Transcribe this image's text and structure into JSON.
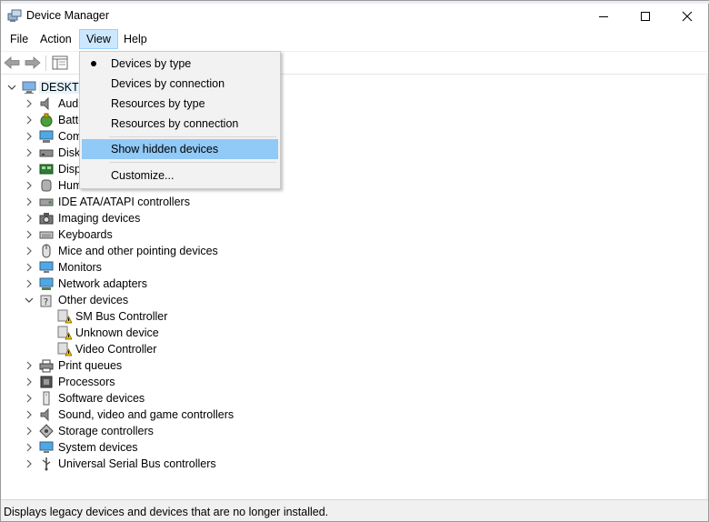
{
  "window": {
    "title": "Device Manager"
  },
  "menubar": {
    "items": [
      "File",
      "Action",
      "View",
      "Help"
    ],
    "active": "View"
  },
  "view_menu": {
    "items": [
      {
        "label": "Devices by type",
        "checked": true
      },
      {
        "label": "Devices by connection"
      },
      {
        "label": "Resources by type"
      },
      {
        "label": "Resources by connection"
      },
      {
        "label": "Show hidden devices",
        "highlighted": true
      },
      {
        "label": "Customize..."
      }
    ]
  },
  "tree": {
    "root": "DESKTO",
    "categories": [
      {
        "label": "Aud",
        "icon": "audio-icon"
      },
      {
        "label": "Batte",
        "icon": "battery-icon"
      },
      {
        "label": "Com",
        "icon": "computer-icon"
      },
      {
        "label": "Disk",
        "icon": "disk-drive-icon"
      },
      {
        "label": "Disp",
        "icon": "display-adapter-icon"
      },
      {
        "label": "Hum",
        "icon": "hid-icon"
      },
      {
        "label": "IDE ATA/ATAPI controllers",
        "icon": "ide-controller-icon"
      },
      {
        "label": "Imaging devices",
        "icon": "camera-icon"
      },
      {
        "label": "Keyboards",
        "icon": "keyboard-icon"
      },
      {
        "label": "Mice and other pointing devices",
        "icon": "mouse-icon"
      },
      {
        "label": "Monitors",
        "icon": "monitor-icon"
      },
      {
        "label": "Network adapters",
        "icon": "network-adapter-icon"
      },
      {
        "label": "Other devices",
        "icon": "other-devices-icon",
        "expanded": true,
        "children": [
          {
            "label": "SM Bus Controller",
            "icon": "warning-device-icon"
          },
          {
            "label": "Unknown device",
            "icon": "warning-device-icon"
          },
          {
            "label": "Video Controller",
            "icon": "warning-device-icon"
          }
        ]
      },
      {
        "label": "Print queues",
        "icon": "printer-icon"
      },
      {
        "label": "Processors",
        "icon": "processor-icon"
      },
      {
        "label": "Software devices",
        "icon": "software-device-icon"
      },
      {
        "label": "Sound, video and game controllers",
        "icon": "speaker-icon"
      },
      {
        "label": "Storage controllers",
        "icon": "storage-controller-icon"
      },
      {
        "label": "System devices",
        "icon": "system-device-icon"
      },
      {
        "label": "Universal Serial Bus controllers",
        "icon": "usb-icon"
      }
    ]
  },
  "status": {
    "text": "Displays legacy devices and devices that are no longer installed."
  }
}
